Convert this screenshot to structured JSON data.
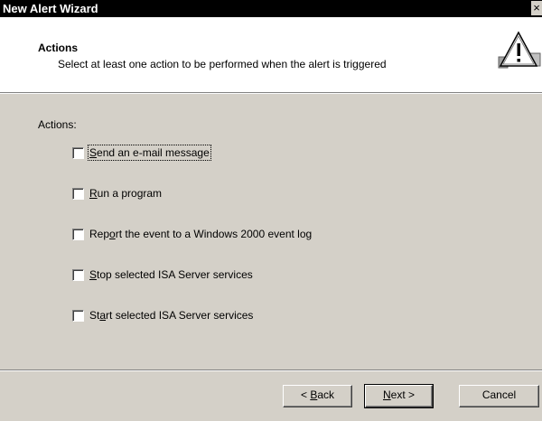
{
  "window": {
    "title": "New Alert Wizard",
    "close_glyph": "×"
  },
  "header": {
    "title": "Actions",
    "subtitle": "Select at least one action to be performed when the alert is triggered",
    "icon": "warning-triangle-icon"
  },
  "main": {
    "section_label": "Actions:",
    "options": [
      {
        "pre": "",
        "key": "S",
        "post": "end an e-mail message",
        "checked": false
      },
      {
        "pre": "",
        "key": "R",
        "post": "un a program",
        "checked": false
      },
      {
        "pre": "Rep",
        "key": "o",
        "post": "rt the event to a Windows 2000 event log",
        "checked": false
      },
      {
        "pre": "",
        "key": "S",
        "post": "top selected ISA Server services",
        "checked": false
      },
      {
        "pre": "St",
        "key": "a",
        "post": "rt selected ISA Server services",
        "checked": false
      }
    ]
  },
  "footer": {
    "back": {
      "pre": "< ",
      "key": "B",
      "post": "ack"
    },
    "next": {
      "pre": "",
      "key": "N",
      "post": "ext >"
    },
    "cancel": "Cancel"
  }
}
